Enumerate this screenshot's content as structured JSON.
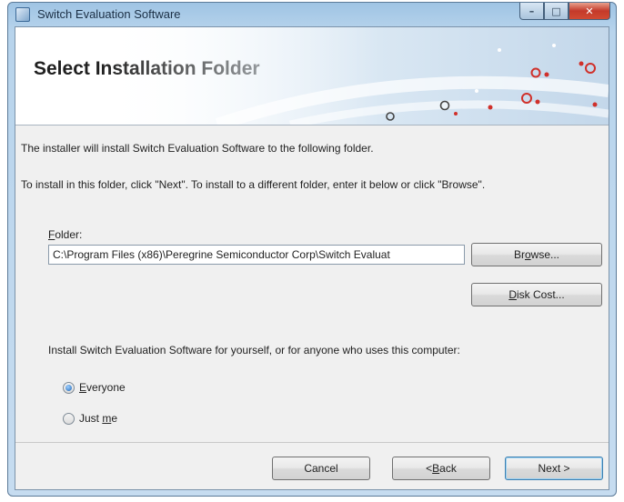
{
  "window": {
    "title": "Switch Evaluation Software"
  },
  "banner": {
    "heading": "Select Installation Folder"
  },
  "intro": {
    "line1": "The installer will install Switch Evaluation Software to the following folder.",
    "line2": "To install in this folder, click \"Next\". To install to a different folder, enter it below or click \"Browse\"."
  },
  "folder": {
    "label_mnemonic": "F",
    "label_rest": "older:",
    "value": "C:\\Program Files (x86)\\Peregrine Semiconductor Corp\\Switch Evaluat"
  },
  "buttons": {
    "browse_pre": "Br",
    "browse_mnemonic": "o",
    "browse_post": "wse...",
    "diskcost_mnemonic": "D",
    "diskcost_post": "isk Cost...",
    "cancel": "Cancel",
    "back_pre": "< ",
    "back_mnemonic": "B",
    "back_post": "ack",
    "next": "Next >"
  },
  "install_for": {
    "prompt": "Install Switch Evaluation Software for yourself, or for anyone who uses this computer:",
    "options": [
      {
        "mnemonic": "E",
        "rest": "veryone",
        "selected": true
      },
      {
        "pre": "Just ",
        "mnemonic": "m",
        "rest": "e",
        "selected": false
      }
    ]
  },
  "colors": {
    "accent_dots": "#d0302a",
    "title_bar": "#b8d4ec"
  }
}
